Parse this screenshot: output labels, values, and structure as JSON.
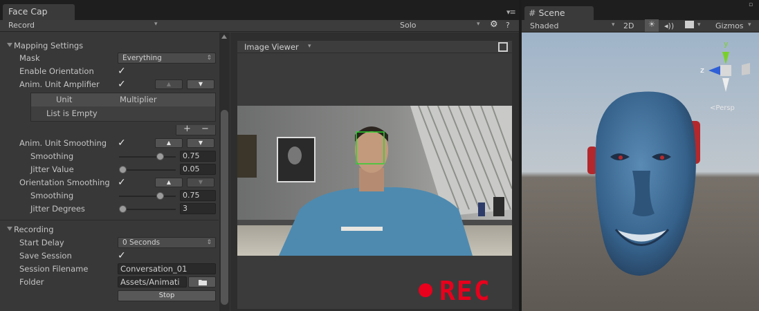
{
  "facecap": {
    "tab_title": "Face Cap",
    "toolbar": {
      "mode": "Record",
      "solo": "Solo",
      "help": "?"
    },
    "mapping": {
      "header": "Mapping Settings",
      "mask_label": "Mask",
      "mask_value": "Everything",
      "enable_orientation_label": "Enable Orientation",
      "amplifier_label": "Anim. Unit Amplifier",
      "list_col_unit": "Unit",
      "list_col_multiplier": "Multiplier",
      "list_empty": "List is Empty",
      "list_add": "+",
      "list_remove": "−",
      "unit_smoothing_label": "Anim. Unit Smoothing",
      "smoothing_label": "Smoothing",
      "smoothing_value": "0.75",
      "jitter_value_label": "Jitter Value",
      "jitter_value": "0.05",
      "orientation_smoothing_label": "Orientation Smoothing",
      "orient_smoothing_label": "Smoothing",
      "orient_smoothing_value": "0.75",
      "jitter_degrees_label": "Jitter Degrees",
      "jitter_degrees_value": "3"
    },
    "recording": {
      "header": "Recording",
      "start_delay_label": "Start Delay",
      "start_delay_value": "0 Seconds",
      "save_session_label": "Save Session",
      "session_filename_label": "Session Filename",
      "session_filename_value": "Conversation_01",
      "folder_label": "Folder",
      "folder_value": "Assets/Animati",
      "stop_label": "Stop"
    },
    "viewer": {
      "title": "Image Viewer",
      "rec_label": "REC"
    }
  },
  "scene": {
    "tab_title": "Scene",
    "toolbar": {
      "shading": "Shaded",
      "two_d": "2D",
      "gizmos": "Gizmos"
    },
    "gizmo": {
      "axis_y": "y",
      "axis_z": "z",
      "projection": "Persp"
    }
  },
  "colors": {
    "rec_red": "#e8001c",
    "gizmo_green": "#7ad02a",
    "gizmo_blue": "#2f5fd6",
    "gizmo_red": "#d43a2e",
    "face_blue": "#3d6f9a"
  }
}
